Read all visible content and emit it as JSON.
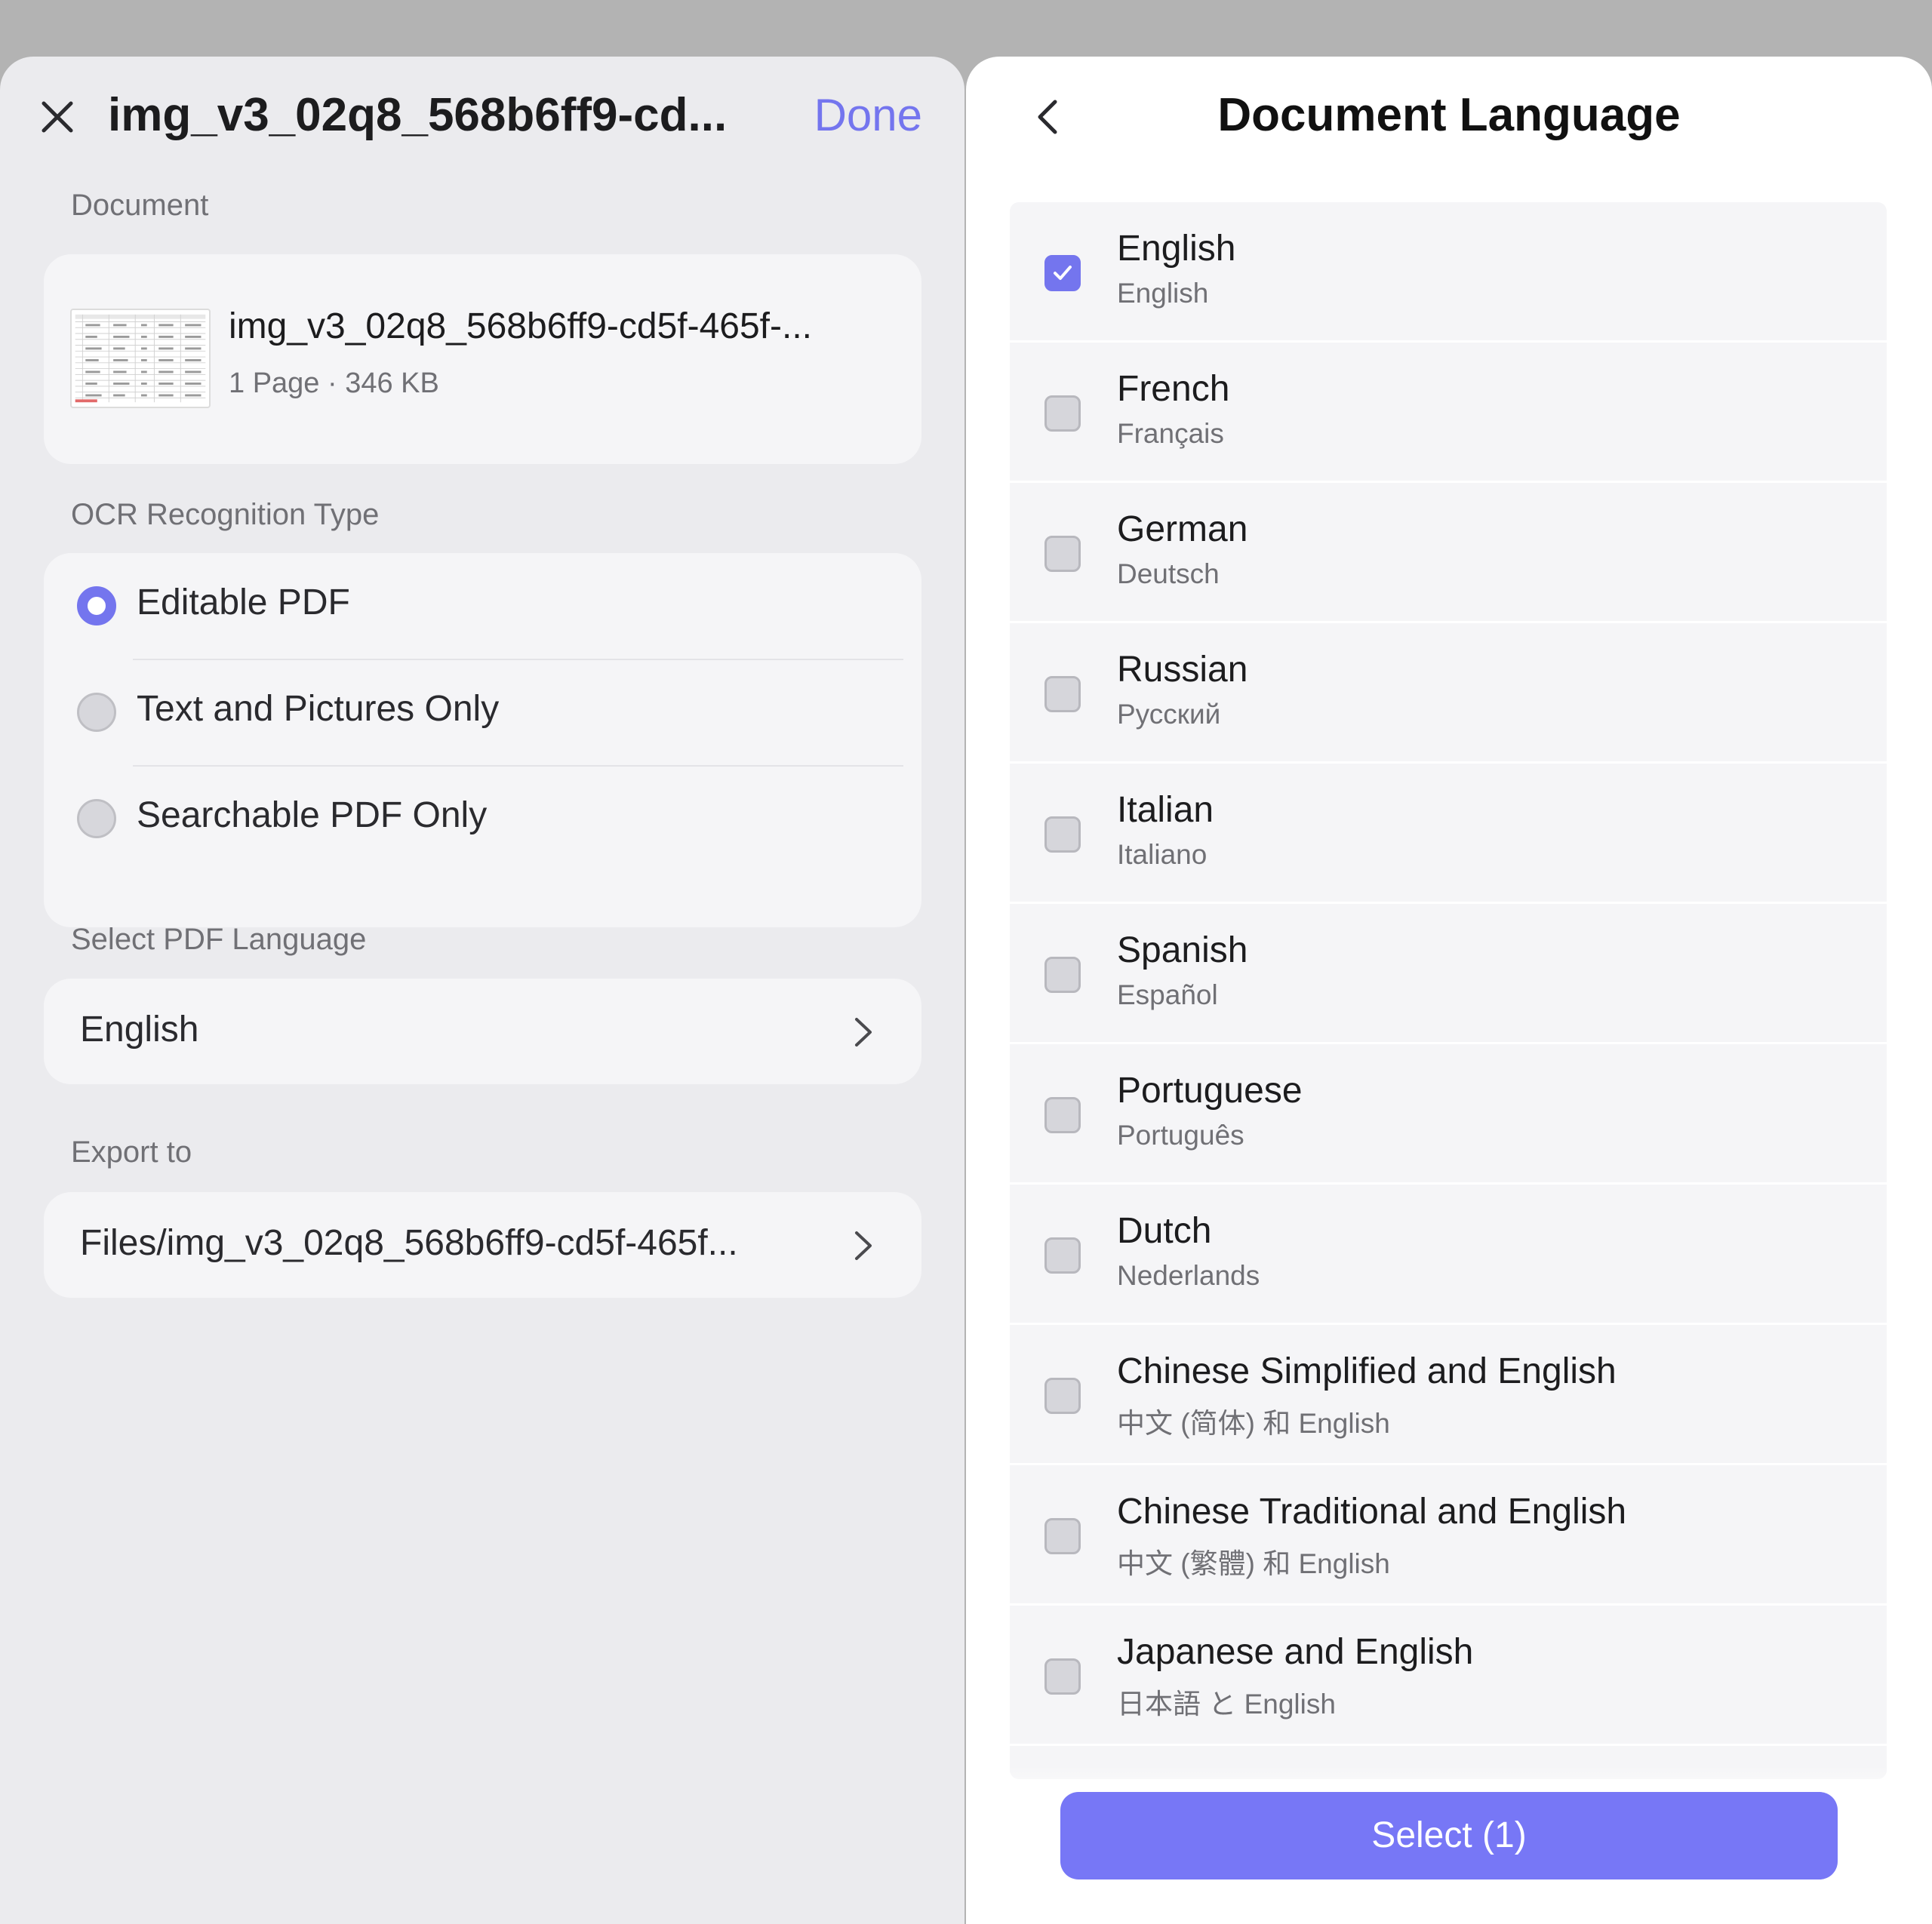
{
  "left": {
    "title": "img_v3_02q8_568b6ff9-cd...",
    "done_label": "Done",
    "document_section_label": "Document",
    "document": {
      "name": "img_v3_02q8_568b6ff9-cd5f-465f-...",
      "meta": "1 Page · 346 KB"
    },
    "ocr_section_label": "OCR Recognition Type",
    "ocr_options": [
      {
        "label": "Editable PDF",
        "selected": true
      },
      {
        "label": "Text and Pictures Only",
        "selected": false
      },
      {
        "label": "Searchable PDF Only",
        "selected": false
      }
    ],
    "language_section_label": "Select PDF Language",
    "language_value": "English",
    "export_section_label": "Export to",
    "export_value": "Files/img_v3_02q8_568b6ff9-cd5f-465f..."
  },
  "right": {
    "title": "Document Language",
    "languages": [
      {
        "name": "English",
        "native": "English",
        "checked": true
      },
      {
        "name": "French",
        "native": "Français",
        "checked": false
      },
      {
        "name": "German",
        "native": "Deutsch",
        "checked": false
      },
      {
        "name": "Russian",
        "native": "Русский",
        "checked": false
      },
      {
        "name": "Italian",
        "native": "Italiano",
        "checked": false
      },
      {
        "name": "Spanish",
        "native": "Español",
        "checked": false
      },
      {
        "name": "Portuguese",
        "native": "Português",
        "checked": false
      },
      {
        "name": "Dutch",
        "native": "Nederlands",
        "checked": false
      },
      {
        "name": "Chinese Simplified and English",
        "native": "中文 (简体) 和 English",
        "checked": false
      },
      {
        "name": "Chinese Traditional and English",
        "native": "中文 (繁體) 和 English",
        "checked": false
      },
      {
        "name": "Japanese and English",
        "native": "日本語 と English",
        "checked": false
      }
    ],
    "select_button_label": "Select (1)"
  },
  "icons": {
    "close": "close-icon",
    "back": "chevron-left-icon",
    "nav": "chevron-right-icon",
    "check": "checkmark-icon"
  },
  "colors": {
    "accent": "#7475ee",
    "button": "#7777f6",
    "left_bg": "#ebebee",
    "card_bg": "#f5f5f7"
  }
}
